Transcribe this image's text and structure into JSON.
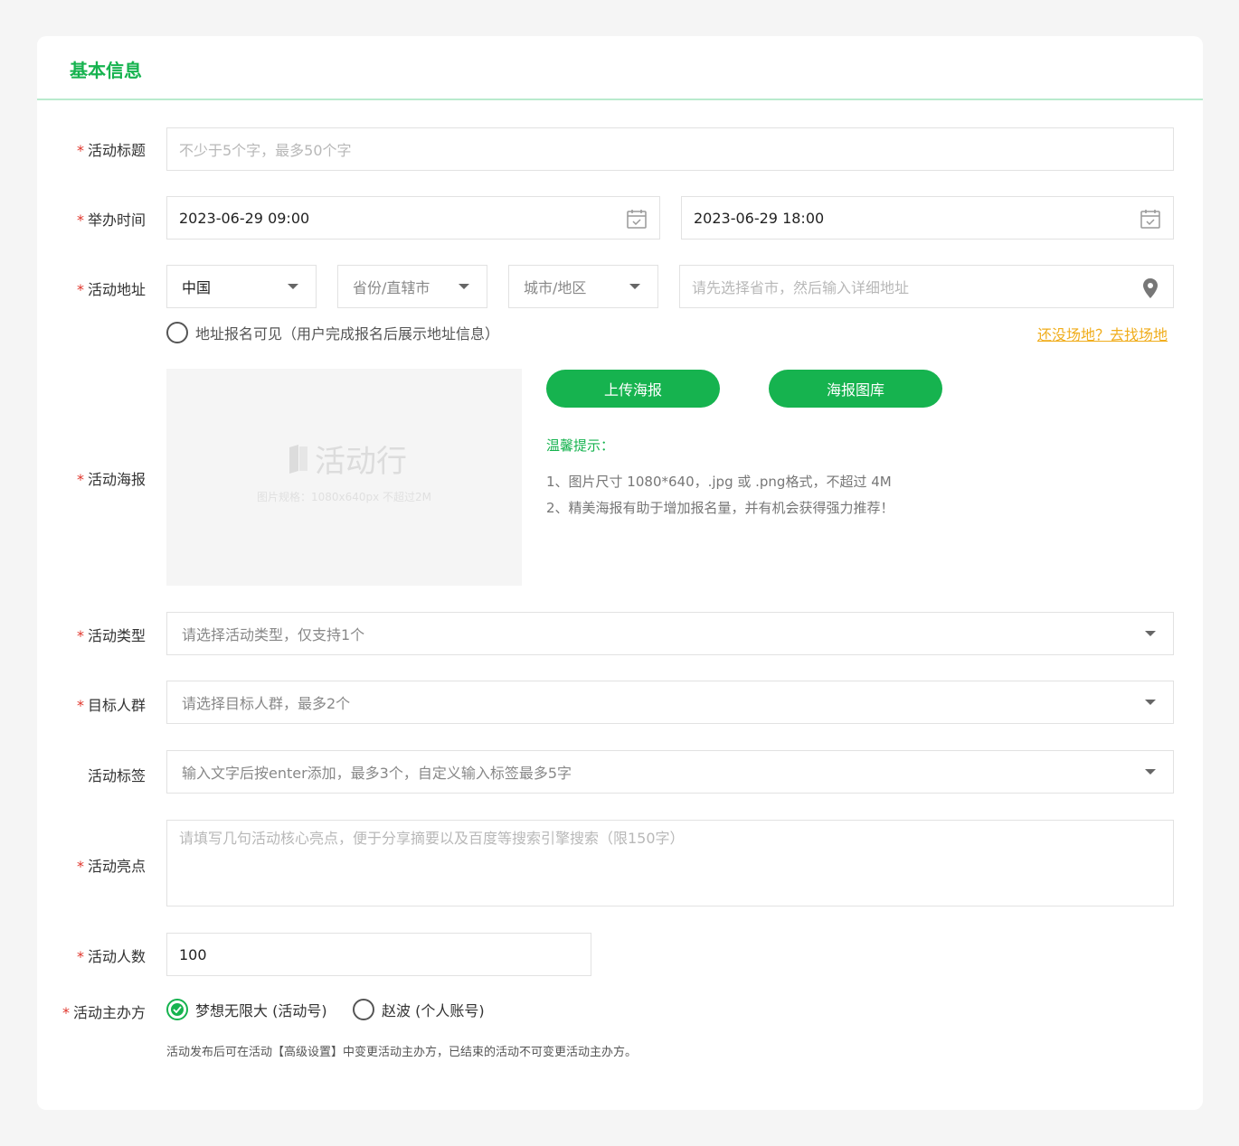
{
  "section": {
    "title": "基本信息"
  },
  "title_field": {
    "label": "活动标题",
    "placeholder": "不少于5个字，最多50个字"
  },
  "time_field": {
    "label": "举办时间",
    "start": "2023-06-29 09:00",
    "end": "2023-06-29 18:00"
  },
  "address_field": {
    "label": "活动地址",
    "country": "中国",
    "province": "省份/直辖市",
    "city": "城市/地区",
    "detail_placeholder": "请先选择省市，然后输入详细地址",
    "visibility_option": "地址报名可见（用户完成报名后展示地址信息）",
    "find_venue_link": "还没场地？去找场地"
  },
  "poster_field": {
    "label": "活动海报",
    "watermark": "活动行",
    "spec_hint": "图片规格：1080x640px 不超过2M",
    "upload_button": "上传海报",
    "gallery_button": "海报图库",
    "tips_title": "温馨提示：",
    "tips": [
      "1、图片尺寸 1080*640，.jpg 或 .png格式，不超过 4M",
      "2、精美海报有助于增加报名量，并有机会获得强力推荐！"
    ]
  },
  "type_field": {
    "label": "活动类型",
    "placeholder": "请选择活动类型，仅支持1个"
  },
  "audience_field": {
    "label": "目标人群",
    "placeholder": "请选择目标人群，最多2个"
  },
  "tags_field": {
    "label": "活动标签",
    "placeholder": "输入文字后按enter添加，最多3个，自定义输入标签最多5字"
  },
  "highlight_field": {
    "label": "活动亮点",
    "placeholder": "请填写几句活动核心亮点，便于分享摘要以及百度等搜索引擎搜索（限150字）"
  },
  "capacity_field": {
    "label": "活动人数",
    "value": "100"
  },
  "organizer_field": {
    "label": "活动主办方",
    "options": [
      {
        "label": "梦想无限大 (活动号)",
        "checked": true
      },
      {
        "label": "赵波 (个人账号)",
        "checked": false
      }
    ],
    "note": "活动发布后可在活动【高级设置】中变更活动主办方，已结束的活动不可变更活动主办方。"
  },
  "colors": {
    "accent": "#16b34f",
    "required": "#e0352b",
    "link": "#f0ad1c"
  }
}
